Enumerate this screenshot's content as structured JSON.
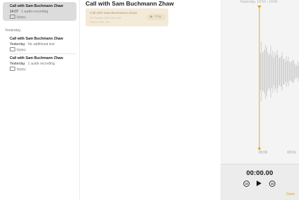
{
  "notes_list": {
    "items": [
      {
        "title": "Call with Sam Buchmann Zhaw",
        "time": "14:07",
        "subtitle": "1 audio recording",
        "folder": "Notes",
        "selected": true
      },
      {
        "title": "Call with Sam Buchmann Zhaw",
        "time": "Yesterday",
        "subtitle": "No additional text",
        "folder": "Notes",
        "selected": false
      },
      {
        "title": "Call with Sam Buchmann Zhaw",
        "time": "Yesterday",
        "subtitle": "1 audio recording",
        "folder": "Notes",
        "selected": false
      }
    ],
    "section_yesterday": "Yesterday"
  },
  "note": {
    "title": "Call with Sam Buchmann Zhaw",
    "audio_card": {
      "title": "Call with Sam Buchmann Zhaw",
      "date": "29 October 2024 at 13:54",
      "duration": "Phone Call · 4m",
      "play_label": "Play"
    }
  },
  "player": {
    "range": "Yesterday, 13:54 - 14:06",
    "timeline_labels": [
      "00:00",
      "00:01"
    ],
    "timer": "00:00.00",
    "skip_back_label": "15",
    "skip_forward_label": "15",
    "done_label": "Done",
    "accent_color": "#e0a21a"
  }
}
